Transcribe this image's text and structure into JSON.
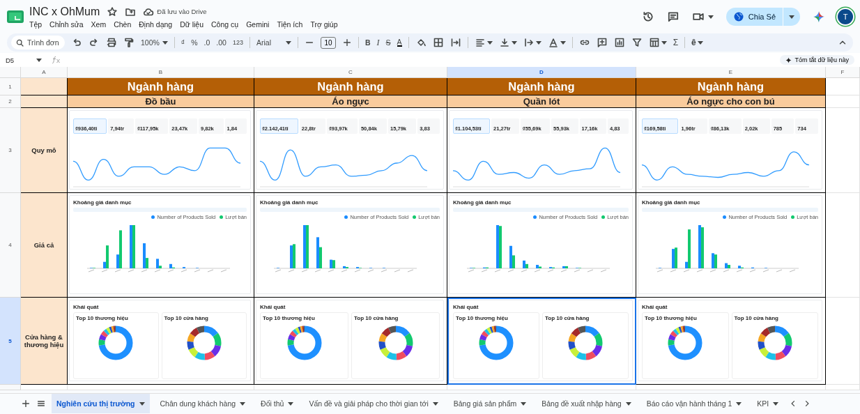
{
  "document": {
    "title": "INC x OhMum",
    "save_status": "Đã lưu vào Drive"
  },
  "menu": [
    "Tệp",
    "Chỉnh sửa",
    "Xem",
    "Chèn",
    "Định dạng",
    "Dữ liệu",
    "Công cụ",
    "Gemini",
    "Tiện ích",
    "Trợ giúp"
  ],
  "share_button": "Chia Sẻ",
  "avatar": "T",
  "toolbar": {
    "search_placeholder": "Trình đơn",
    "zoom": "100%",
    "currency": "₫",
    "percent": "%",
    "decimal_decrease": ".0",
    "decimal_increase": ".00",
    "number_format": "123",
    "font": "Arial",
    "font_size": "10",
    "bold": "B",
    "italic": "I",
    "strikethrough": "S",
    "text_color": "A",
    "sum": "Σ",
    "input_tools": "ê"
  },
  "formula_bar": {
    "cell": "D5",
    "summarize_button": "Tóm tắt dữ liệu này"
  },
  "columns": [
    {
      "label": "A",
      "selected": false
    },
    {
      "label": "B",
      "selected": false
    },
    {
      "label": "C",
      "selected": false
    },
    {
      "label": "D",
      "selected": true
    },
    {
      "label": "E",
      "selected": false
    },
    {
      "label": "F",
      "selected": false
    }
  ],
  "rows": [
    {
      "label": "1",
      "selected": false
    },
    {
      "label": "2",
      "selected": false
    },
    {
      "label": "3",
      "selected": false
    },
    {
      "label": "4",
      "selected": false
    },
    {
      "label": "5",
      "selected": true
    }
  ],
  "row_labels": [
    "Quy mô",
    "Giá cả",
    "Cửa hàng & thương hiệu"
  ],
  "categories": [
    {
      "heading": "Ngành hàng",
      "name": "Đồ bầu",
      "metrics": [
        {
          "value": "₫936,40tỉ",
          "selected": true
        },
        {
          "value": "7,94tr",
          "selected": false
        },
        {
          "value": "₫117,95k",
          "selected": false
        },
        {
          "value": "23,47k",
          "selected": false
        },
        {
          "value": "9,82k",
          "selected": false
        },
        {
          "value": "1,84",
          "selected": false
        }
      ],
      "price_title": "Khoảng giá danh mục",
      "legend": [
        {
          "label": "Number of Products Sold",
          "color": "#1a8cff"
        },
        {
          "label": "Lượt bán",
          "color": "#12c96f"
        }
      ],
      "overview_title": "Khái quát",
      "brands_title": "Top 10 thương hiệu",
      "stores_title": "Top 10 cửa hàng",
      "cell_selected": false
    },
    {
      "heading": "Ngành hàng",
      "name": "Áo ngực",
      "metrics": [
        {
          "value": "₫2.142,41tỉ",
          "selected": true
        },
        {
          "value": "22,8tr",
          "selected": false
        },
        {
          "value": "₫93,97k",
          "selected": false
        },
        {
          "value": "50,84k",
          "selected": false
        },
        {
          "value": "15,79k",
          "selected": false
        },
        {
          "value": "3,83",
          "selected": false
        }
      ],
      "price_title": "Khoảng giá danh mục",
      "legend": [
        {
          "label": "Number of Products Sold",
          "color": "#1a8cff"
        },
        {
          "label": "Lượt bán",
          "color": "#12c96f"
        }
      ],
      "overview_title": "Khái quát",
      "brands_title": "Top 10 thương hiệu",
      "stores_title": "Top 10 cửa hàng",
      "cell_selected": false
    },
    {
      "heading": "Ngành hàng",
      "name": "Quần lót",
      "metrics": [
        {
          "value": "₫1.104,53tỉ",
          "selected": true
        },
        {
          "value": "21,27tr",
          "selected": false
        },
        {
          "value": "₫55,69k",
          "selected": false
        },
        {
          "value": "55,93k",
          "selected": false
        },
        {
          "value": "17,16k",
          "selected": false
        },
        {
          "value": "4,83",
          "selected": false
        }
      ],
      "price_title": "Khoảng giá danh mục",
      "legend": [
        {
          "label": "Number of Products Sold",
          "color": "#1a8cff"
        },
        {
          "label": "Lượt bán",
          "color": "#12c96f"
        }
      ],
      "overview_title": "Khái quát",
      "brands_title": "Top 10 thương hiệu",
      "stores_title": "Top 10 cửa hàng",
      "cell_selected": true
    },
    {
      "heading": "Ngành hàng",
      "name": "Áo ngực cho con bú",
      "metrics": [
        {
          "value": "₫169,58tỉ",
          "selected": true
        },
        {
          "value": "1,96tr",
          "selected": false
        },
        {
          "value": "₫86,13k",
          "selected": false
        },
        {
          "value": "2,02k",
          "selected": false
        },
        {
          "value": "785",
          "selected": false
        },
        {
          "value": "734",
          "selected": false
        }
      ],
      "price_title": "Khoảng giá danh mục",
      "legend": [
        {
          "label": "Number of Products Sold",
          "color": "#1a8cff"
        },
        {
          "label": "Lượt bán",
          "color": "#12c96f"
        }
      ],
      "overview_title": "Khái quát",
      "brands_title": "Top 10 thương hiệu",
      "stores_title": "Top 10 cửa hàng",
      "cell_selected": false
    }
  ],
  "sheet_tabs": [
    {
      "label": "Nghiên cứu thị trường",
      "selected": true
    },
    {
      "label": "Chân dung khách hàng",
      "selected": false
    },
    {
      "label": "Đối thủ",
      "selected": false
    },
    {
      "label": "Vấn đề và giải pháp cho thời gian tới",
      "selected": false
    },
    {
      "label": "Bảng giá sản phẩm",
      "selected": false
    },
    {
      "label": "Bảng đề xuất nhập hàng",
      "selected": false
    },
    {
      "label": "Báo cáo vận hành tháng 1",
      "selected": false
    },
    {
      "label": "KPI",
      "selected": false
    }
  ]
}
